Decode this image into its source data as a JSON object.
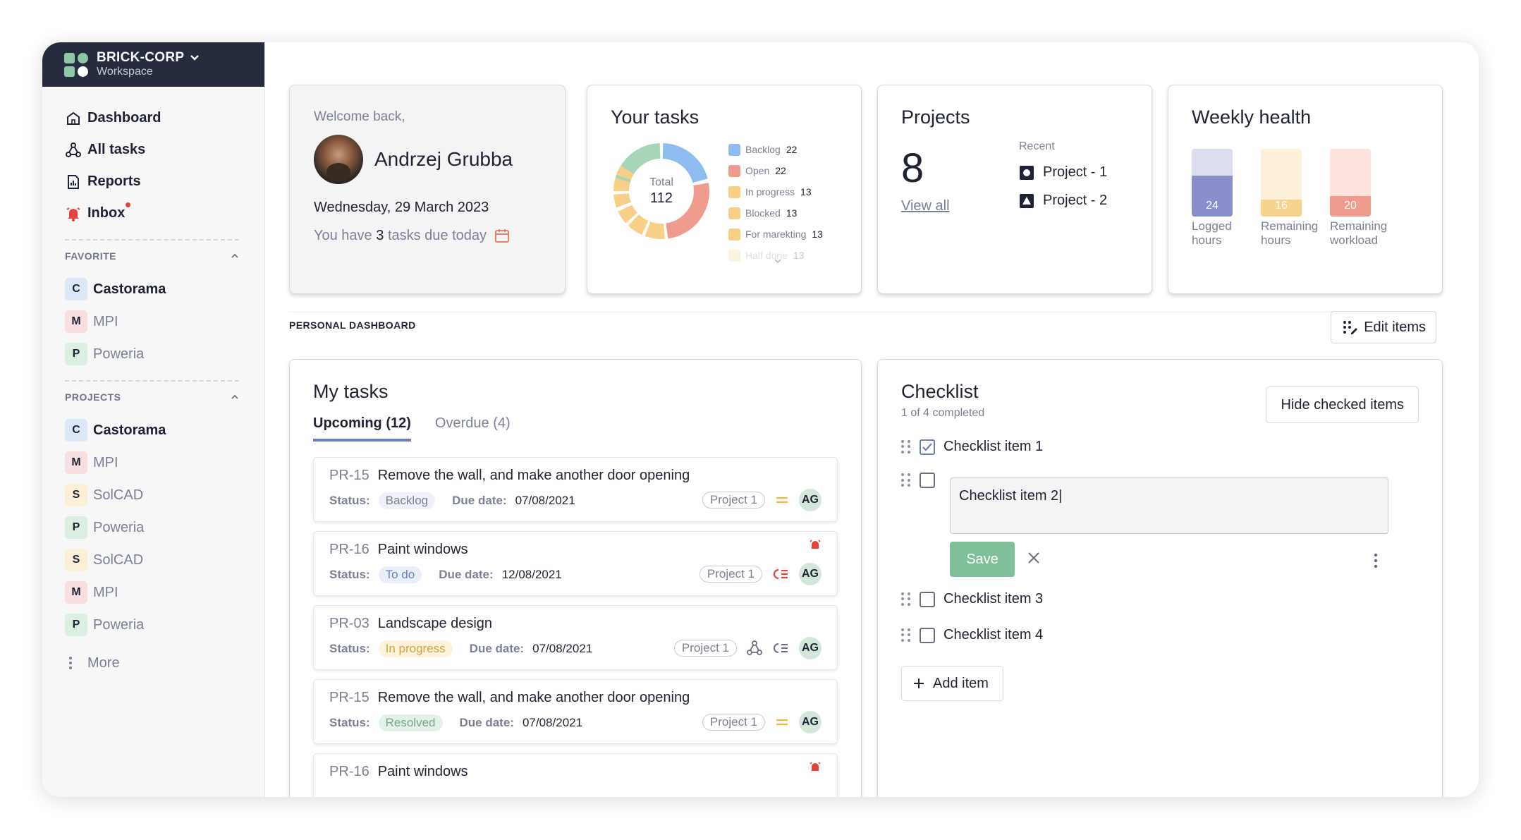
{
  "workspace": {
    "name": "BRICK-CORP",
    "sub": "Workspace"
  },
  "nav": [
    {
      "label": "Dashboard",
      "icon": "home-icon"
    },
    {
      "label": "All tasks",
      "icon": "tasks-icon"
    },
    {
      "label": "Reports",
      "icon": "report-icon"
    },
    {
      "label": "Inbox",
      "icon": "bell-icon"
    }
  ],
  "favorite": {
    "title": "FAVORITE",
    "items": [
      {
        "letter": "C",
        "label": "Castorama",
        "color": "#dde8f7"
      },
      {
        "letter": "M",
        "label": "MPI",
        "color": "#f8dfe0"
      },
      {
        "letter": "P",
        "label": "Poweria",
        "color": "#dcf0e2"
      }
    ]
  },
  "projects_nav": {
    "title": "PROJECTS",
    "items": [
      {
        "letter": "C",
        "label": "Castorama",
        "color": "#dde8f7"
      },
      {
        "letter": "M",
        "label": "MPI",
        "color": "#f8dfe0"
      },
      {
        "letter": "S",
        "label": "SolCAD",
        "color": "#fbefd8"
      },
      {
        "letter": "P",
        "label": "Poweria",
        "color": "#dcf0e2"
      },
      {
        "letter": "S",
        "label": "SolCAD",
        "color": "#fbefd8"
      },
      {
        "letter": "M",
        "label": "MPI",
        "color": "#f8dfe0"
      },
      {
        "letter": "P",
        "label": "Poweria",
        "color": "#dcf0e2"
      }
    ],
    "more": "More"
  },
  "welcome": {
    "label": "Welcome back,",
    "name": "Andrzej Grubba",
    "date": "Wednesday, 29 March 2023",
    "due_pre": "You have",
    "due_count": "3",
    "due_post": "tasks due today"
  },
  "tasks_card": {
    "title": "Your tasks",
    "total_label": "Total",
    "total": "112",
    "legend": [
      {
        "label": "Backlog",
        "count": "22",
        "color": "#8fbdf2"
      },
      {
        "label": "Open",
        "count": "22",
        "color": "#ef9b8e"
      },
      {
        "label": "In progress",
        "count": "13",
        "color": "#f7cf86"
      },
      {
        "label": "Blocked",
        "count": "13",
        "color": "#f7cf86"
      },
      {
        "label": "For marekting",
        "count": "13",
        "color": "#f7cf86"
      },
      {
        "label": "Half done",
        "count": "13",
        "color": "#f7cf86"
      }
    ]
  },
  "projects_card": {
    "title": "Projects",
    "count": "8",
    "view_all": "View all",
    "recent_label": "Recent",
    "recent": [
      "Project - 1",
      "Project - 2"
    ]
  },
  "health": {
    "title": "Weekly health",
    "bars": [
      {
        "value": "24",
        "label1": "Logged",
        "label2": "hours",
        "fill": 0.6,
        "bg": "#dcdef0",
        "fg": "#8a8fcb"
      },
      {
        "value": "16",
        "label1": "Remaining",
        "label2": "hours",
        "fill": 0.25,
        "bg": "#fdf0da",
        "fg": "#f6d48e"
      },
      {
        "value": "20",
        "label1": "Remaining",
        "label2": "workload",
        "fill": 0.3,
        "bg": "#fde2de",
        "fg": "#ef9b8e"
      }
    ]
  },
  "personal": {
    "label": "PERSONAL DASHBOARD",
    "edit": "Edit items"
  },
  "mytasks": {
    "title": "My tasks",
    "tabs": [
      "Upcoming (12)",
      "Overdue (4)"
    ],
    "status_label": "Status:",
    "due_label": "Due date:",
    "items": [
      {
        "id": "PR-15",
        "title": "Remove the wall, and make another door opening",
        "status": "Backlog",
        "status_bg": "#eef1f8",
        "status_fg": "#7b8094",
        "due": "07/08/2021",
        "project": "Project 1",
        "avatar": "AG",
        "priority": "equal-icon",
        "alarm": false
      },
      {
        "id": "PR-16",
        "title": "Paint windows",
        "status": "To do",
        "status_bg": "#e9eefb",
        "status_fg": "#6b7fc2",
        "due": "12/08/2021",
        "project": "Project 1",
        "avatar": "AG",
        "priority": "high-priority-icon",
        "alarm": true
      },
      {
        "id": "PR-03",
        "title": "Landscape design",
        "status": "In progress",
        "status_bg": "#fdf2dc",
        "status_fg": "#d6a23e",
        "due": "07/08/2021",
        "project": "Project 1",
        "avatar": "AG",
        "priority": "list-icon",
        "alarm": false
      },
      {
        "id": "PR-15",
        "title": "Remove the wall, and make another door opening",
        "status": "Resolved",
        "status_bg": "#e3f2e8",
        "status_fg": "#7ba58a",
        "due": "07/08/2021",
        "project": "Project 1",
        "avatar": "AG",
        "priority": "equal-icon",
        "alarm": false
      },
      {
        "id": "PR-16",
        "title": "Paint windows",
        "status": "",
        "status_bg": "#ffffff",
        "status_fg": "#7b8094",
        "due": "",
        "project": "",
        "avatar": "",
        "priority": "",
        "alarm": true
      }
    ]
  },
  "checklist": {
    "title": "Checklist",
    "sub": "1 of 4 completed",
    "hide": "Hide checked items",
    "items": [
      "Checklist item 1",
      "Checklist item 2|",
      "Checklist item 3",
      "Checklist item 4"
    ],
    "save": "Save",
    "add": "Add item"
  }
}
